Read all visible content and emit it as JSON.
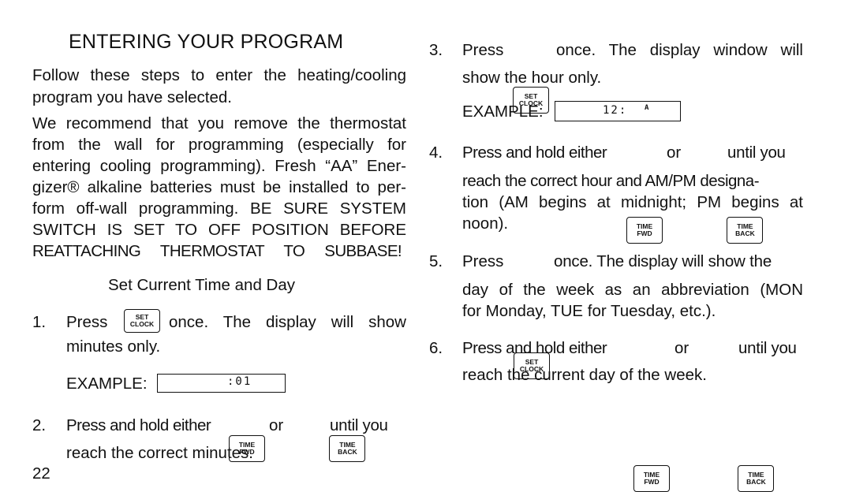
{
  "page": {
    "number": "22",
    "title": "ENTERING YOUR PROGRAM",
    "intro": "Follow these steps to enter the heating/cooling program you have selected.",
    "intro_lines": [
      "Follow these steps to enter the heating/cooling",
      "program you have selected."
    ],
    "warning_lines": [
      "We recommend that you remove the thermostat",
      "from the wall for programming (especially for",
      "entering cooling programming). Fresh “AA” Ener-",
      "gizer® alkaline batteries must be installed to per-",
      "form off-wall programming. BE SURE SYSTEM",
      "SWITCH IS SET TO OFF POSITION BEFORE",
      "REATTACHING THERMOSTAT TO SUBBASE!"
    ],
    "subheading": "Set Current Time and Day"
  },
  "keys": {
    "set_clock": [
      "SET",
      "CLOCK"
    ],
    "time_fwd": [
      "TIME",
      "FWD"
    ],
    "time_back": [
      "TIME",
      "BACK"
    ]
  },
  "steps": [
    {
      "number": "1.",
      "pre": "Press",
      "post": "once. The display will show",
      "line2": "minutes only.",
      "example_label": "EXAMPLE:",
      "display": ":01",
      "display_indicator": ""
    },
    {
      "number": "2.",
      "pre": "Press and hold either",
      "mid": "or",
      "post": "until you",
      "line2": "reach the correct minutes."
    },
    {
      "number": "3.",
      "pre": "Press",
      "post": "once. The display window will",
      "line2": "show the hour only.",
      "example_label": "EXAMPLE:",
      "display": "12:",
      "display_indicator": "A"
    },
    {
      "number": "4.",
      "pre": "Press and hold either",
      "mid": "or",
      "post": "until you",
      "lines": [
        "reach the correct hour and AM/PM designa-",
        "tion (AM begins at midnight; PM begins at",
        "noon)."
      ]
    },
    {
      "number": "5.",
      "pre": "Press",
      "post": "once. The display will show the",
      "lines": [
        "day of the week as an abbreviation (MON",
        "for Monday, TUE for Tuesday, etc.)."
      ]
    },
    {
      "number": "6.",
      "pre": "Press and hold either",
      "mid": "or",
      "post": "until you",
      "lines": [
        "reach the current day of the week."
      ]
    }
  ]
}
